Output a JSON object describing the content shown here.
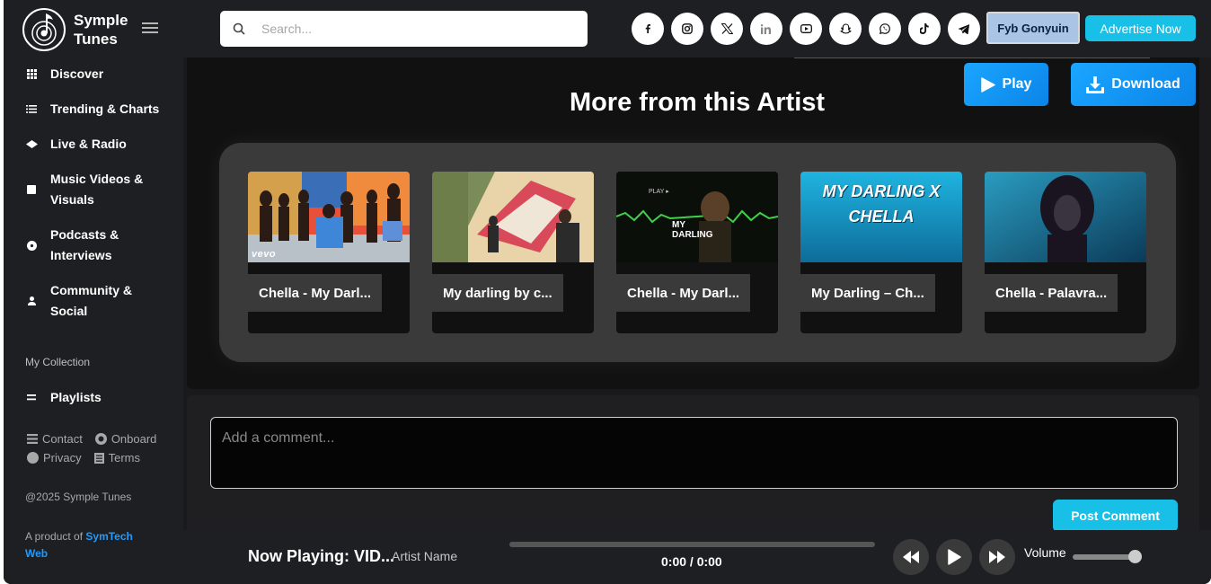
{
  "brand": {
    "name": "Symple Tunes",
    "logo_icon": "music-note-logo"
  },
  "sidebar": {
    "items": [
      {
        "label": "Discover",
        "icon": "grid-icon"
      },
      {
        "label": "Trending & Charts",
        "icon": "list-icon"
      },
      {
        "label": "Live & Radio",
        "icon": "broadcast-icon"
      },
      {
        "label": "Music Videos & Visuals",
        "icon": "video-icon"
      },
      {
        "label": "Podcasts & Interviews",
        "icon": "podcast-icon"
      },
      {
        "label": "Community & Social",
        "icon": "user-icon"
      }
    ],
    "collection_label": "My Collection",
    "playlists_label": "Playlists",
    "footer_links": [
      "Contact",
      "Onboard",
      "Privacy",
      "Terms"
    ],
    "copyright": "@2025 Symple Tunes",
    "product_prefix": "A product of ",
    "product_link": "SymTech Web"
  },
  "topbar": {
    "search_placeholder": "Search...",
    "socials": [
      "facebook-icon",
      "instagram-icon",
      "x-icon",
      "linkedin-icon",
      "youtube-icon",
      "snapchat-icon",
      "whatsapp-icon",
      "tiktok-icon",
      "telegram-icon"
    ],
    "user_name": "Fyb Gonyuin",
    "advertise_label": "Advertise Now"
  },
  "main": {
    "play_label": "Play",
    "download_label": "Download",
    "section_title": "More from this Artist",
    "cards": [
      {
        "title": "Chella - My Darl...",
        "thumb_text": "vevo"
      },
      {
        "title": "My darling by c...",
        "thumb_text": ""
      },
      {
        "title": "Chella - My Darl...",
        "thumb_text": "MY DARLING"
      },
      {
        "title": "My Darling – Ch...",
        "thumb_text": "MY DARLING X CHELLA"
      },
      {
        "title": "Chella - Palavra...",
        "thumb_text": ""
      }
    ],
    "comment_placeholder": "Add a comment...",
    "post_comment_label": "Post Comment"
  },
  "player": {
    "now_playing": "Now Playing: VID...",
    "artist": "Artist Name",
    "time": "0:00 / 0:00",
    "progress": 0,
    "volume_label": "Volume",
    "volume": 1.0
  }
}
